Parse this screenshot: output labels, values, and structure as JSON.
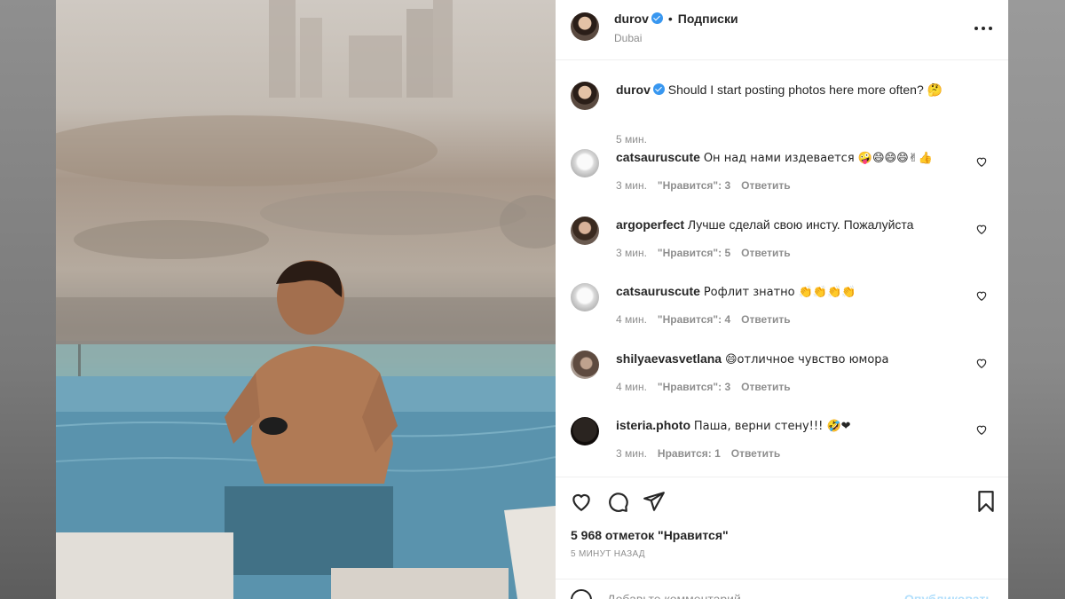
{
  "post": {
    "author": "durov",
    "follow_label": "Подписки",
    "location": "Dubai",
    "caption": "Should I start posting photos here more often? 🤔",
    "caption_time": "5 мин."
  },
  "comments": [
    {
      "user": "catsauruscute",
      "text": "Он над нами издевается 🤪😄😄😄✌👍",
      "time": "3 мин.",
      "likes": "\"Нравится\": 3",
      "reply": "Ответить"
    },
    {
      "user": "argoperfect",
      "text": "Лучше сделай свою инсту. Пожалуйста",
      "time": "3 мин.",
      "likes": "\"Нравится\": 5",
      "reply": "Ответить"
    },
    {
      "user": "catsauruscute",
      "text": "Рофлит знатно 👏👏👏👏",
      "time": "4 мин.",
      "likes": "\"Нравится\": 4",
      "reply": "Ответить"
    },
    {
      "user": "shilyaevasvetlana",
      "text": "😄отличное чувство юмора",
      "time": "4 мин.",
      "likes": "\"Нравится\": 3",
      "reply": "Ответить"
    },
    {
      "user": "isteria.photo",
      "text": "Паша, верни стену!!! 🤣❤",
      "time": "3 мин.",
      "likes": "Нравится: 1",
      "reply": "Ответить"
    }
  ],
  "actions": {
    "likes_count": "5 968 отметок \"Нравится\"",
    "posted_ago": "5 МИНУТ НАЗАД",
    "comment_placeholder": "Добавьте комментарий...",
    "publish_label": "Опубликовать"
  },
  "icons": [
    "more-icon",
    "verified-icon",
    "heart-icon",
    "comment-icon",
    "share-icon",
    "bookmark-icon",
    "emoji-icon"
  ],
  "colors": {
    "verified": "#3897f0",
    "muted": "#8e8e8e",
    "publish_disabled": "#b2dffc"
  }
}
